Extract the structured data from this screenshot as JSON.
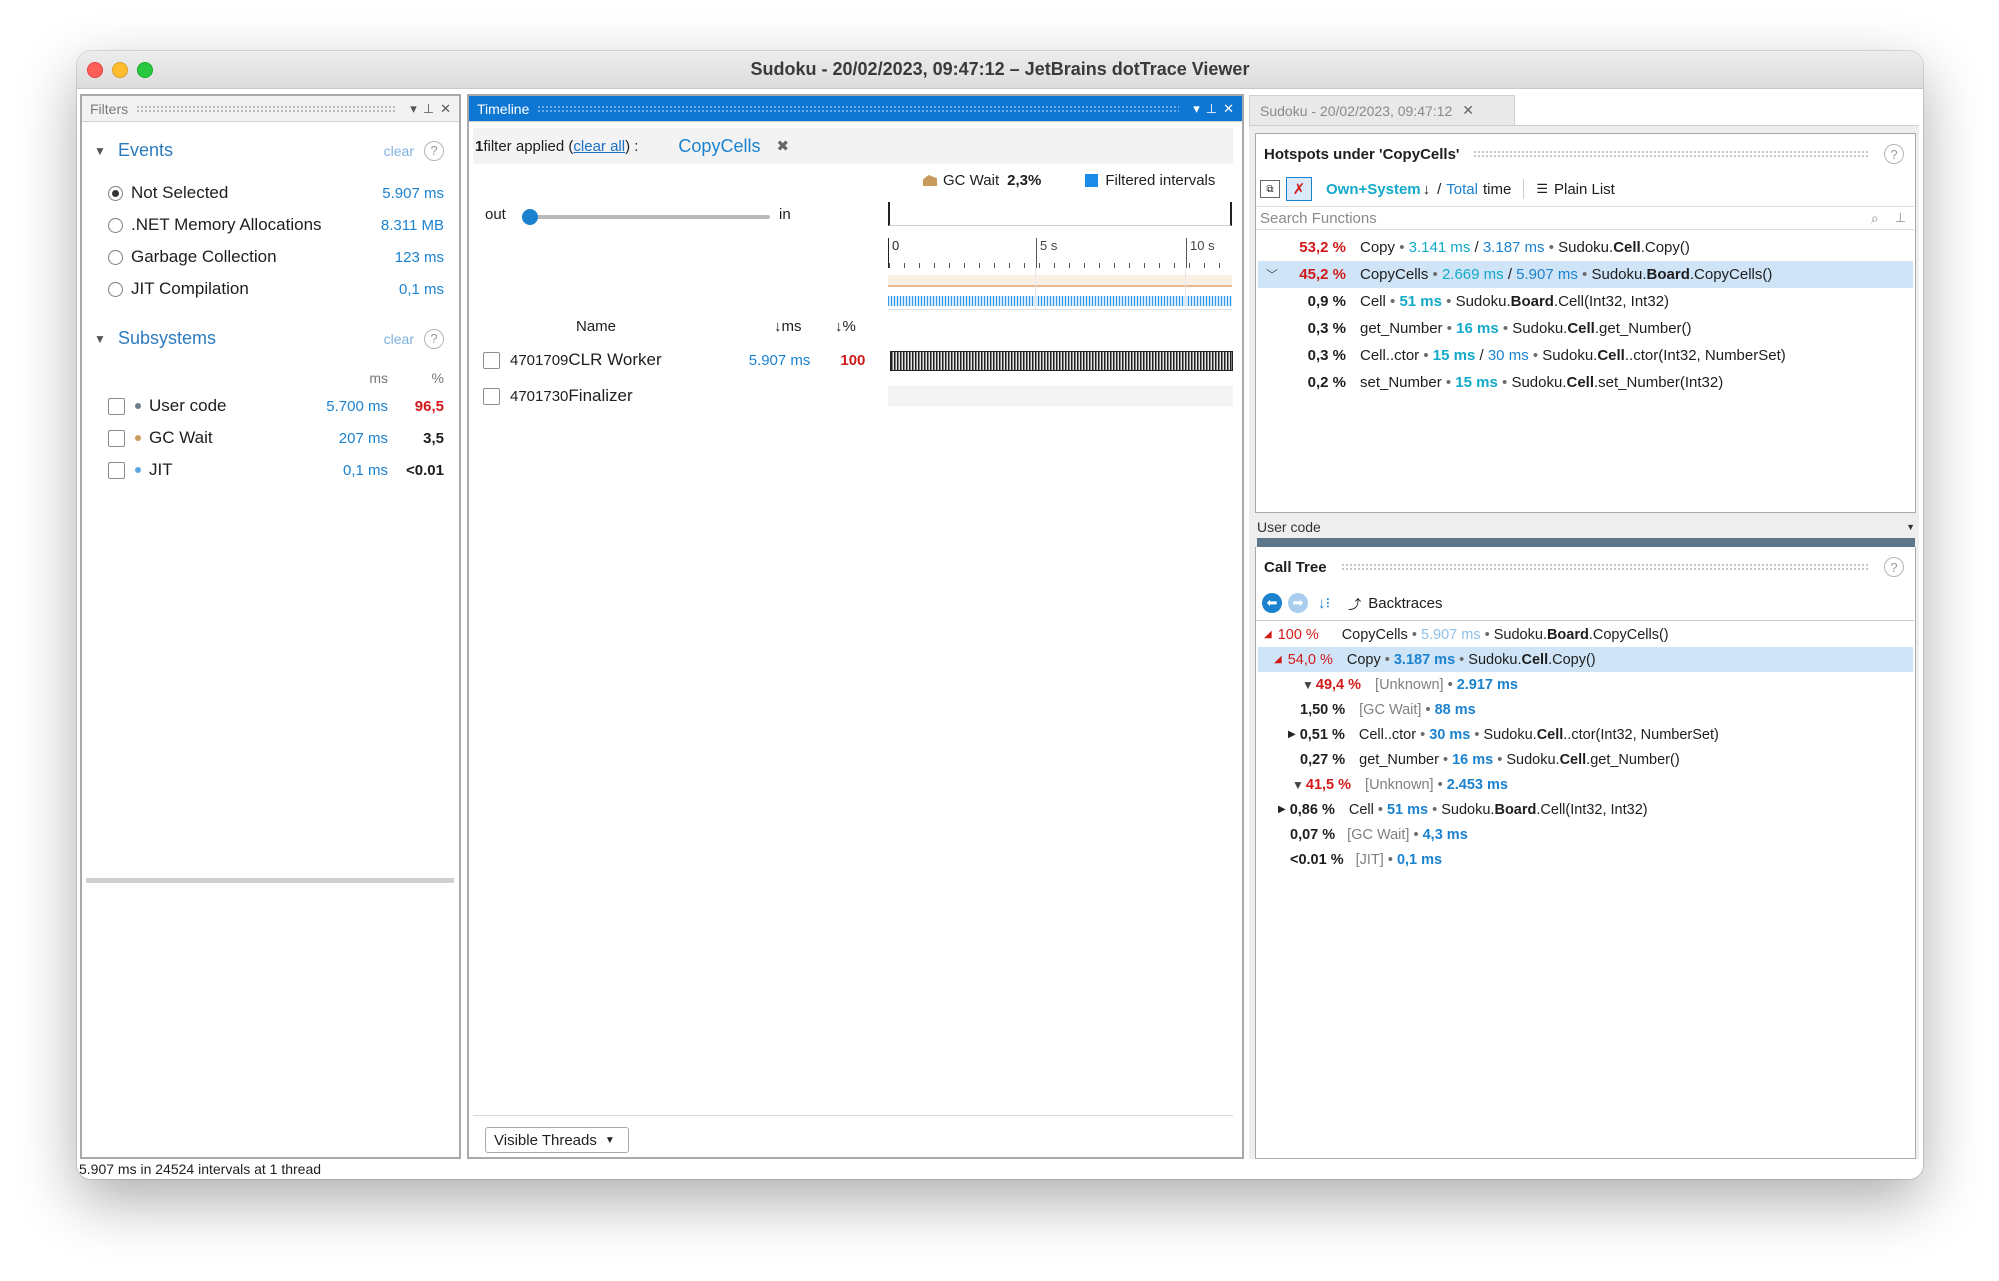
{
  "window": {
    "title": "Sudoku - 20/02/2023, 09:47:12 – JetBrains dotTrace Viewer"
  },
  "filters": {
    "header": "Filters",
    "events": {
      "title": "Events",
      "clear": "clear",
      "items": [
        {
          "label": "Not Selected",
          "value": "5.907 ms"
        },
        {
          "label": ".NET Memory Allocations",
          "value": "8.311 MB"
        },
        {
          "label": "Garbage Collection",
          "value": "123 ms"
        },
        {
          "label": "JIT Compilation",
          "value": "0,1 ms"
        }
      ]
    },
    "subsystems": {
      "title": "Subsystems",
      "clear": "clear",
      "col_ms": "ms",
      "col_pct": "%",
      "items": [
        {
          "label": "User code",
          "ms": "5.700 ms",
          "pct": "96,5",
          "dot_color": "#6d7d8e",
          "pct_color": "#d21a1a"
        },
        {
          "label": "GC Wait",
          "ms": "207 ms",
          "pct": "3,5",
          "dot_color": "#c89a5e",
          "pct_color": "#1e1e1e"
        },
        {
          "label": "JIT",
          "ms": "0,1 ms",
          "pct": "<0.01",
          "dot_color": "#5aa9e6",
          "pct_color": "#1e1e1e"
        }
      ]
    }
  },
  "timeline": {
    "header": "Timeline",
    "filter_count": "1",
    "filter_text": " filter applied (",
    "clear_all": "clear all",
    "filter_tail": ") :",
    "chip": "CopyCells",
    "legend_gc": "GC Wait",
    "legend_gc_pct": "2,3%",
    "legend_filtered": "Filtered intervals",
    "zoom_out": "out",
    "zoom_in": "in",
    "ticks": [
      "0",
      "5 s",
      "10 s"
    ],
    "col_name": "Name",
    "col_ms": "↓ms",
    "col_pct": "↓%",
    "threads": [
      {
        "id": "4701709",
        "name": "CLR Worker",
        "ms": "5.907 ms",
        "pct": "100"
      },
      {
        "id": "4701730",
        "name": "Finalizer",
        "ms": "",
        "pct": ""
      }
    ],
    "visible_threads": "Visible Threads"
  },
  "right": {
    "tab": "Sudoku - 20/02/2023, 09:47:12",
    "hotspots": {
      "title": "Hotspots under 'CopyCells'",
      "own_system": "Own+System",
      "sort_arrow": "↓",
      "total": "Total",
      "time": "time",
      "plain_list": "Plain List",
      "search_placeholder": "Search Functions",
      "rows": [
        {
          "pct": "53,2 %",
          "name": "Copy",
          "own": "3.141 ms",
          "total": "3.187 ms",
          "ns": "Sudoku.",
          "cls": "Cell",
          "method": ".Copy()"
        },
        {
          "pct": "45,2 %",
          "name": "CopyCells",
          "own": "2.669 ms",
          "total": "5.907 ms",
          "ns": "Sudoku.",
          "cls": "Board",
          "method": ".CopyCells()"
        },
        {
          "pct": "0,9 %",
          "name": "Cell",
          "own": "51 ms",
          "total": "",
          "ns": "Sudoku.",
          "cls": "Board",
          "method": ".Cell(Int32, Int32)"
        },
        {
          "pct": "0,3 %",
          "name": "get_Number",
          "own": "16 ms",
          "total": "",
          "ns": "Sudoku.",
          "cls": "Cell",
          "method": ".get_Number()"
        },
        {
          "pct": "0,3 %",
          "name": "Cell..ctor",
          "own": "15 ms",
          "total": "30 ms",
          "ns": "Sudoku.",
          "cls": "Cell",
          "method": "..ctor(Int32, NumberSet)"
        },
        {
          "pct": "0,2 %",
          "name": "set_Number",
          "own": "15 ms",
          "total": "",
          "ns": "Sudoku.",
          "cls": "Cell",
          "method": ".set_Number(Int32)"
        }
      ]
    },
    "subsystem_select": "User code",
    "calltree": {
      "title": "Call Tree",
      "backtraces": "Backtraces",
      "rows": [
        {
          "pct": "100 %",
          "name": "CopyCells",
          "ms": "5.907 ms",
          "ns": "Sudoku.",
          "cls": "Board",
          "method": ".CopyCells()"
        },
        {
          "pct": "54,0 %",
          "name": "Copy",
          "ms": "3.187 ms",
          "ns": "Sudoku.",
          "cls": "Cell",
          "method": ".Copy()"
        },
        {
          "pct": "49,4 %",
          "name": "[Unknown]",
          "ms": "2.917 ms"
        },
        {
          "pct": "1,50 %",
          "name": "[GC Wait]",
          "ms": "88 ms"
        },
        {
          "pct": "0,51 %",
          "name": "Cell..ctor",
          "ms": "30 ms",
          "ns": "Sudoku.",
          "cls": "Cell",
          "method": "..ctor(Int32, NumberSet)"
        },
        {
          "pct": "0,27 %",
          "name": "get_Number",
          "ms": "16 ms",
          "ns": "Sudoku.",
          "cls": "Cell",
          "method": ".get_Number()"
        },
        {
          "pct": "41,5 %",
          "name": "[Unknown]",
          "ms": "2.453 ms"
        },
        {
          "pct": "0,86 %",
          "name": "Cell",
          "ms": "51 ms",
          "ns": "Sudoku.",
          "cls": "Board",
          "method": ".Cell(Int32, Int32)"
        },
        {
          "pct": "0,07 %",
          "name": "[GC Wait]",
          "ms": "4,3 ms"
        },
        {
          "pct": "<0.01 %",
          "name": "[JIT]",
          "ms": "0,1 ms"
        }
      ]
    }
  },
  "status": "5.907 ms in 24524 intervals at 1 thread",
  "colors": {
    "accent": "#0e77d3",
    "value_blue": "#1b82cf",
    "hot_red": "#d21a1a",
    "cyan": "#13a9c8",
    "selection": "#cfe4f7"
  }
}
